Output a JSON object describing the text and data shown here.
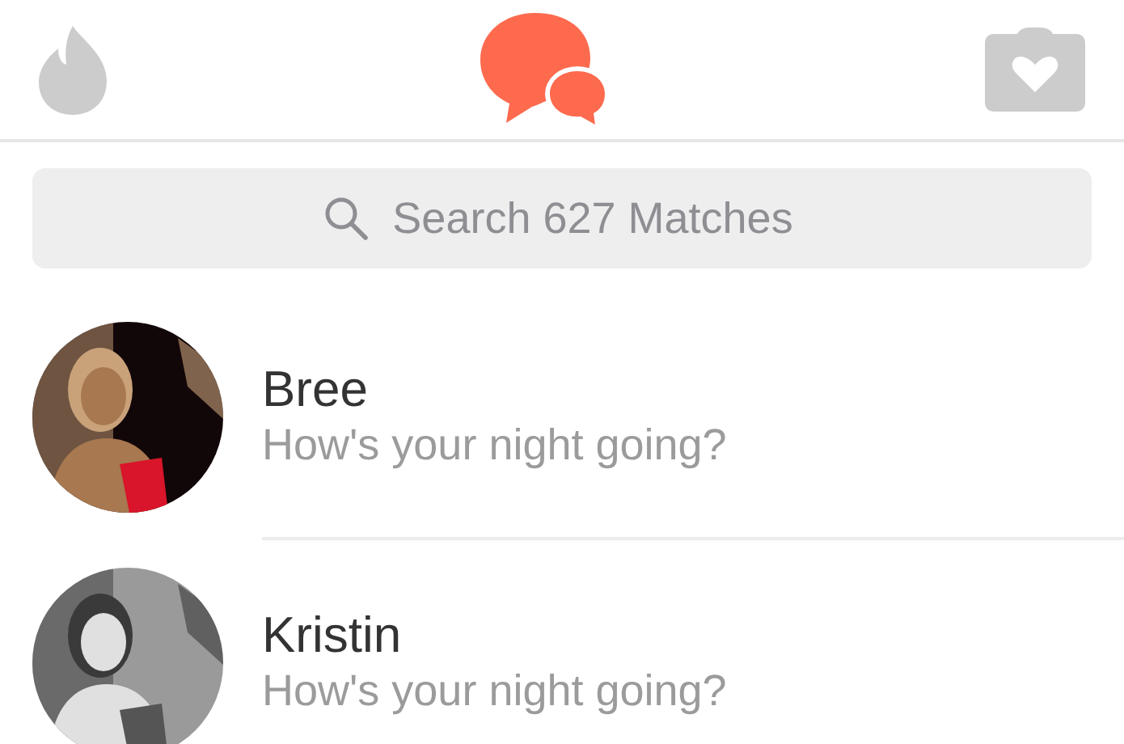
{
  "tabs": [
    {
      "kind": "flame",
      "selected": false
    },
    {
      "kind": "chat",
      "selected": true
    },
    {
      "kind": "camera",
      "selected": false
    }
  ],
  "search": {
    "placeholder": "Search 627 Matches"
  },
  "matches": [
    {
      "name": "Bree",
      "message": "How's your night going?"
    },
    {
      "name": "Kristin",
      "message": "How's your night going?"
    }
  ]
}
